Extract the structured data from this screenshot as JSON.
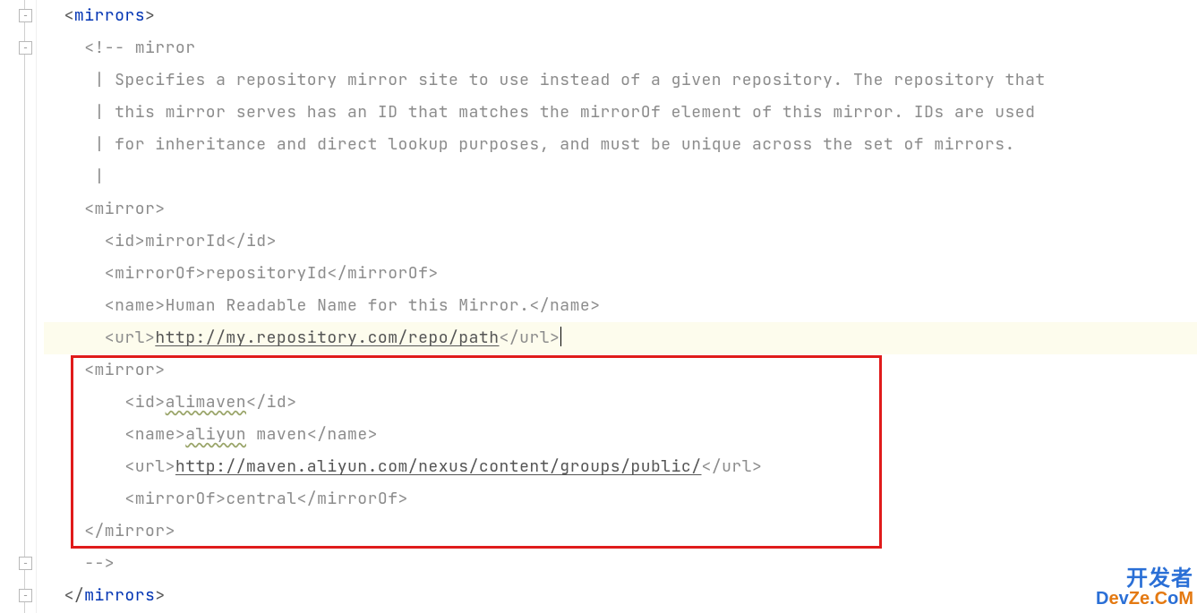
{
  "lines": {
    "l1": {
      "tag": "mirrors"
    },
    "l2": {
      "text": "<!-- mirror"
    },
    "l3": {
      "text": " | Specifies a repository mirror site to use instead of a given repository. The repository that"
    },
    "l4": {
      "text": " | this mirror serves has an ID that matches the mirrorOf element of this mirror. IDs are used"
    },
    "l5": {
      "text": " | for inheritance and direct lookup purposes, and must be unique across the set of mirrors."
    },
    "l6": {
      "text": " |"
    },
    "l7": {
      "text": "<mirror>"
    },
    "l8": {
      "text": "  <id>mirrorId</id>"
    },
    "l9": {
      "text": "  <mirrorOf>repositoryId</mirrorOf>"
    },
    "l10": {
      "text": "  <name>Human Readable Name for this Mirror.</name>"
    },
    "l11": {
      "open": "  <url>",
      "link": "http://my.repository.com/repo/path",
      "close": "</url>"
    },
    "l12": {
      "text": "<mirror>"
    },
    "l13": {
      "open": "    <id>",
      "val": "alimaven",
      "close": "</id>"
    },
    "l14": {
      "open": "    <name>",
      "val": "aliyun",
      "rest": " maven",
      "close": "</name>"
    },
    "l15": {
      "open": "    <url>",
      "link": "http://maven.aliyun.com/nexus/content/groups/public/",
      "close": "</url>"
    },
    "l16": {
      "text": "    <mirrorOf>central</mirrorOf>"
    },
    "l17": {
      "text": "</mirror>"
    },
    "l18": {
      "text": "-->"
    },
    "l19": {
      "tag": "mirrors"
    }
  },
  "watermark": {
    "top": "开发者",
    "bottom": "DevZe.CoM"
  }
}
